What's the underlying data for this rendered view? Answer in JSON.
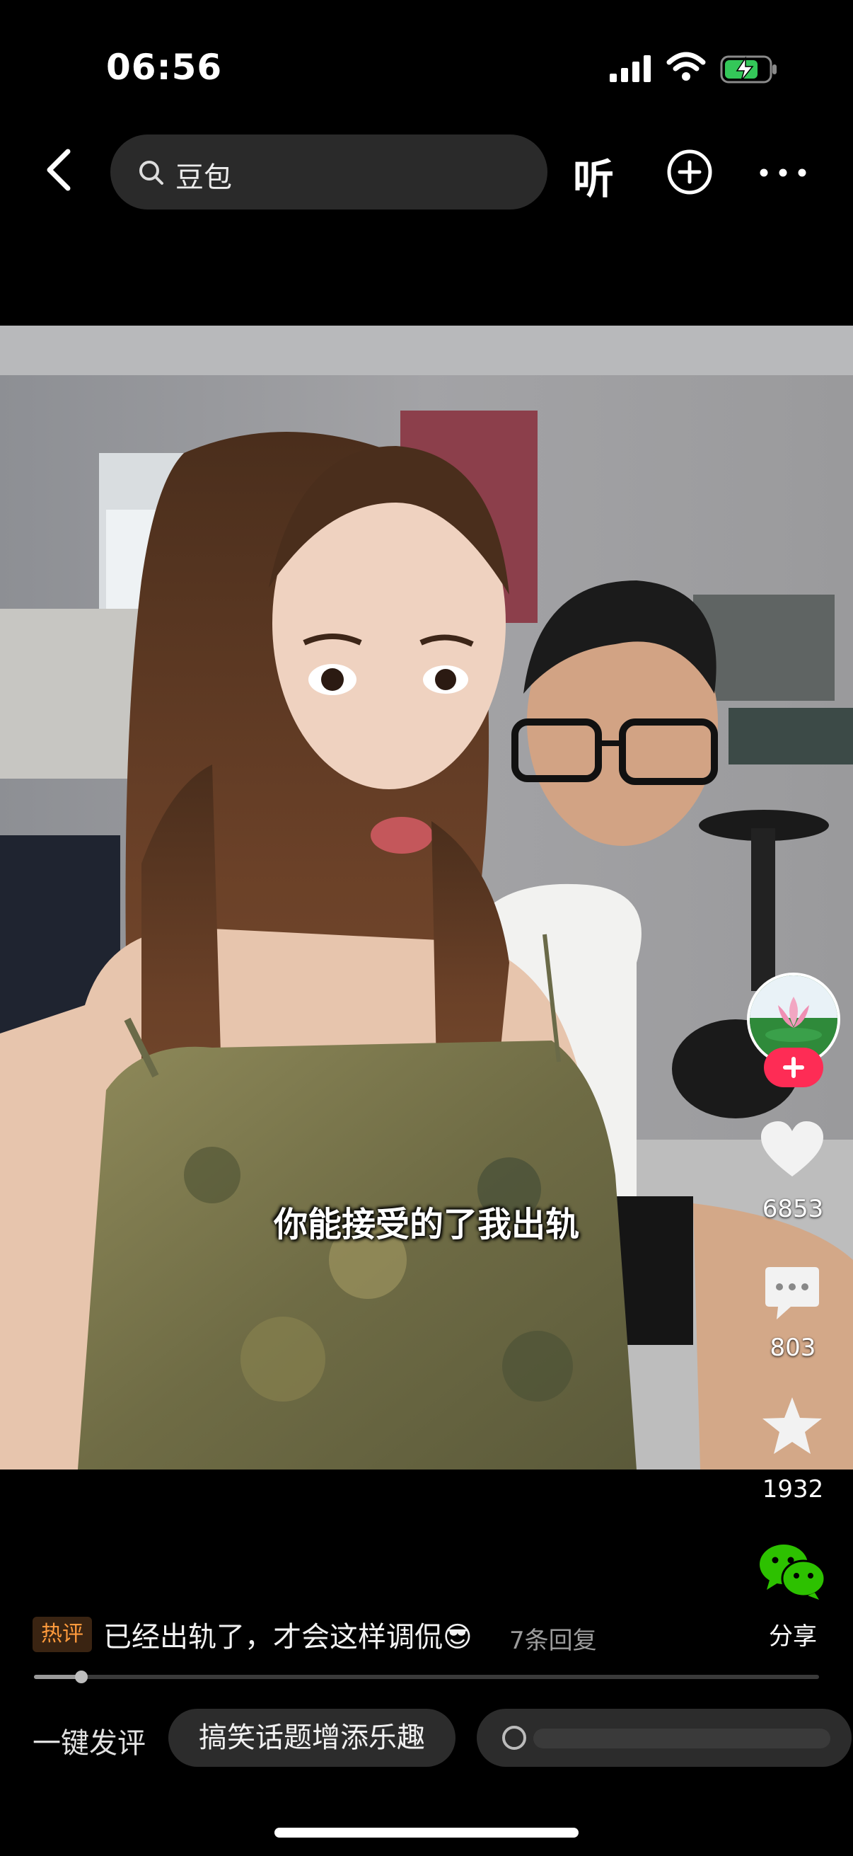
{
  "status_bar": {
    "time": "06:56"
  },
  "search": {
    "query": "豆包"
  },
  "nav": {
    "listen_label": "听"
  },
  "video": {
    "subtitle": "你能接受的了我出轨"
  },
  "actions": {
    "like_count": "6853",
    "comment_count": "803",
    "favorite_count": "1932",
    "share_label": "分享"
  },
  "hot_comment": {
    "badge": "热评",
    "text": "已经出轨了，才会这样调侃😎",
    "replies": "7条回复"
  },
  "progress": {
    "fraction": 0.06
  },
  "quick_comment": {
    "label": "一键发评",
    "chips": [
      "搞笑话题增添乐趣"
    ]
  },
  "colors": {
    "follow": "#fe2c55",
    "hot_badge": "#ff9a3c",
    "battery": "#34c759"
  }
}
